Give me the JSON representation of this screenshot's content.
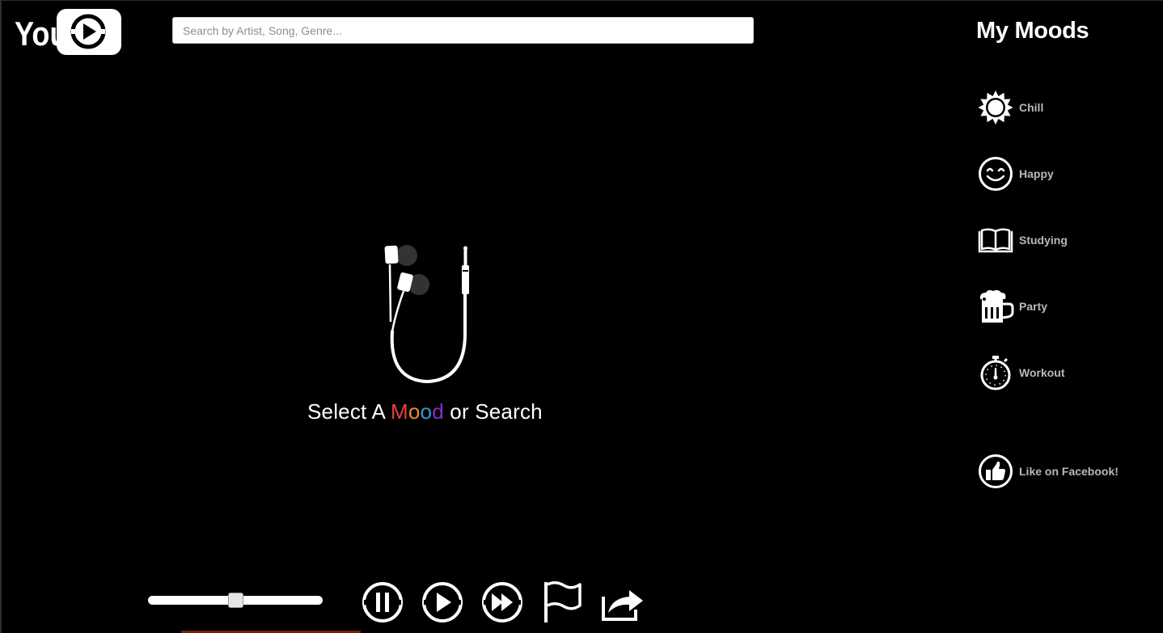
{
  "logo": {
    "text": "You",
    "icon": "youtube-play-icon"
  },
  "search": {
    "placeholder": "Search by Artist, Song, Genre...",
    "value": ""
  },
  "sidebar": {
    "title": "My Moods",
    "moods": [
      {
        "label": "Chill",
        "icon": "sun-icon"
      },
      {
        "label": "Happy",
        "icon": "smiley-icon"
      },
      {
        "label": "Studying",
        "icon": "book-icon"
      },
      {
        "label": "Party",
        "icon": "beer-mug-icon"
      },
      {
        "label": "Workout",
        "icon": "stopwatch-icon"
      }
    ],
    "facebook": {
      "label": "Like on Facebook!",
      "icon": "thumbs-up-icon"
    }
  },
  "main": {
    "prompt_prefix": "Select A ",
    "prompt_mood": [
      "M",
      "o",
      "o",
      "d"
    ],
    "prompt_suffix": " or Search",
    "hero_icon": "earbuds-icon",
    "mood_colors": [
      "#e8413e",
      "#f08a2c",
      "#2f9ad8",
      "#8b2cc9"
    ]
  },
  "player": {
    "volume_fraction": 0.5,
    "controls": [
      {
        "name": "pause-button",
        "icon": "pause-icon"
      },
      {
        "name": "play-button",
        "icon": "play-icon"
      },
      {
        "name": "fast-forward-button",
        "icon": "fast-forward-icon"
      },
      {
        "name": "flag-button",
        "icon": "flag-icon"
      },
      {
        "name": "share-button",
        "icon": "share-icon"
      }
    ]
  }
}
